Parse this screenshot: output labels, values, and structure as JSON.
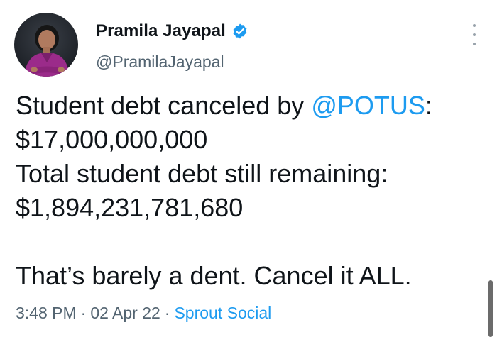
{
  "author": {
    "display_name": "Pramila Jayapal",
    "handle": "@PramilaJayapal",
    "verified": true
  },
  "tweet": {
    "line1_prefix": "Student debt canceled by ",
    "line1_mention": "@POTUS",
    "line1_suffix": ":",
    "line2": "$17,000,000,000",
    "line3": "Total student debt still remaining:",
    "line4": "$1,894,231,781,680",
    "line5": "That’s barely a dent. Cancel it ALL."
  },
  "meta": {
    "time": "3:48 PM",
    "separator": "·",
    "date": "02 Apr 22",
    "source": "Sprout Social"
  },
  "icons": {
    "verified": "verified-badge-icon",
    "more": "more-options-icon"
  },
  "colors": {
    "link": "#1d9bf0",
    "secondary_text": "#536471",
    "primary_text": "#0f1419"
  }
}
